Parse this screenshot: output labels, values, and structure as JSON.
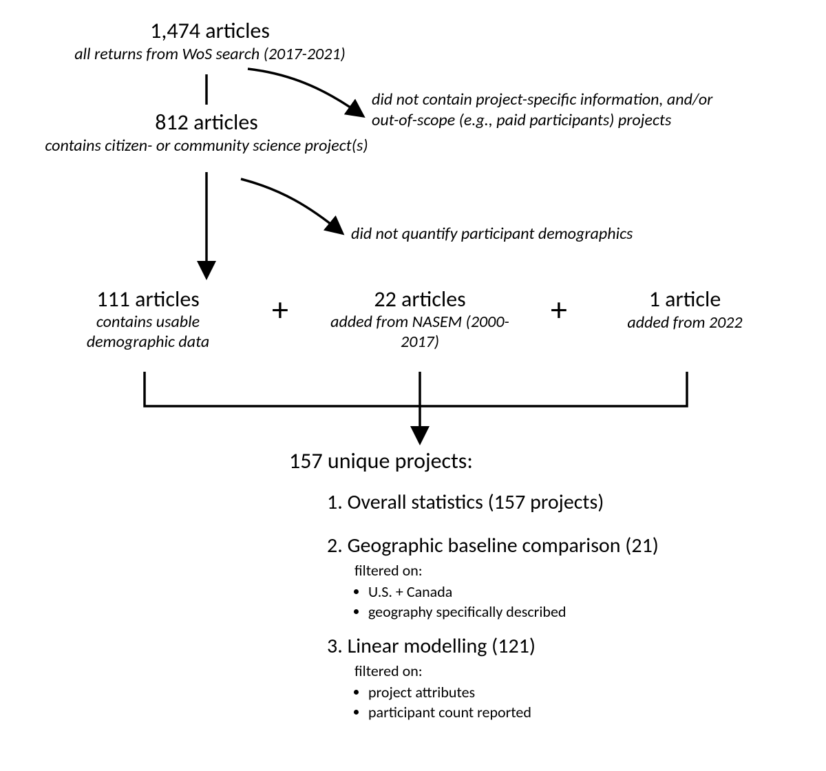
{
  "chart_data": {
    "type": "flowchart",
    "nodes": [
      {
        "id": "n1",
        "count": "1,474",
        "label": "articles",
        "sub": "all returns from WoS search (2017-2021)"
      },
      {
        "id": "n2",
        "count": "812",
        "label": "articles",
        "sub": "contains citizen- or community science project(s)"
      },
      {
        "id": "n3",
        "count": "111",
        "label": "articles",
        "sub": "contains usable demographic data"
      },
      {
        "id": "n4",
        "count": "22",
        "label": "articles",
        "sub": "added from NASEM (2000-2017)"
      },
      {
        "id": "n5",
        "count": "1",
        "label": "article",
        "sub": "added from 2022"
      }
    ],
    "plus": "+",
    "exclusions": [
      {
        "id": "e1",
        "text_a": "did not contain project-specific information, and/or",
        "text_b": "out-of-scope (e.g., paid participants) projects"
      },
      {
        "id": "e2",
        "text_a": "did not quantify participant demographics"
      }
    ],
    "result_title": "157 unique projects:",
    "outcomes": [
      {
        "num": "1.",
        "text": "Overall statistics (157 projects)"
      },
      {
        "num": "2.",
        "text": "Geographic baseline comparison (21)",
        "filter_label": "filtered on:",
        "bullets": [
          "U.S. + Canada",
          "geography specifically described"
        ]
      },
      {
        "num": "3.",
        "text": "Linear modelling (121)",
        "filter_label": "filtered on:",
        "bullets": [
          "project attributes",
          "participant count reported"
        ]
      }
    ]
  }
}
